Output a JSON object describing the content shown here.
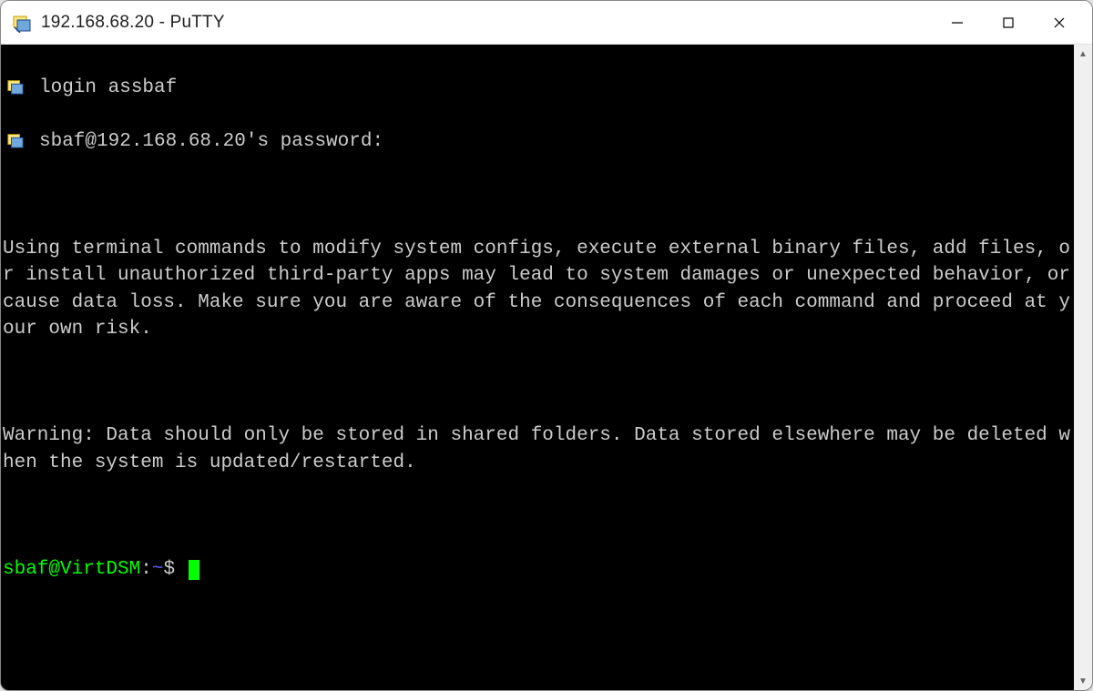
{
  "window": {
    "title": "192.168.68.20 - PuTTY"
  },
  "terminal": {
    "login_line": "login assbaf",
    "password_line": "sbaf@192.168.68.20's password:",
    "warning1": "Using terminal commands to modify system configs, execute external binary files, add files, or install unauthorized third-party apps may lead to system damages or unexpected behavior, or cause data loss. Make sure you are aware of the consequences of each command and proceed at your own risk.",
    "warning2": "Warning: Data should only be stored in shared folders. Data stored elsewhere may be deleted when the system is updated/restarted.",
    "prompt": {
      "user_host": "sbaf@VirtDSM",
      "colon": ":",
      "path": "~",
      "dollar": "$ "
    }
  }
}
